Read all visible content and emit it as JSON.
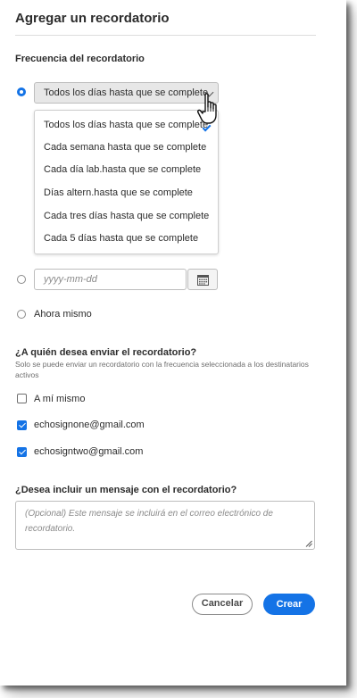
{
  "dialog": {
    "title": "Agregar un recordatorio"
  },
  "frequency": {
    "heading": "Frecuencia del recordatorio",
    "selected": "Todos los días hasta que se complete",
    "options": [
      "Todos los días hasta que se complete",
      "Cada semana hasta que se complete",
      "Cada día lab.hasta que se complete",
      "Días altern.hasta que se complete",
      "Cada tres días hasta que se complete",
      "Cada 5 días hasta que se complete"
    ],
    "date_placeholder": "yyyy-mm-dd",
    "now_label": "Ahora mismo"
  },
  "recipients": {
    "heading": "¿A quién desea enviar el recordatorio?",
    "note": "Solo se puede enviar un recordatorio con la frecuencia seleccionada a los destinatarios activos",
    "items": [
      {
        "label": "A mí mismo",
        "checked": false
      },
      {
        "label": "echosignone@gmail.com",
        "checked": true
      },
      {
        "label": "echosigntwo@gmail.com",
        "checked": true
      }
    ]
  },
  "message": {
    "heading": "¿Desea incluir un mensaje con el recordatorio?",
    "placeholder": "(Opcional) Este mensaje se incluirá en el correo electrónico de recordatorio."
  },
  "actions": {
    "cancel_label": "Cancelar",
    "create_label": "Crear"
  },
  "colors": {
    "accent": "#1473e6"
  }
}
